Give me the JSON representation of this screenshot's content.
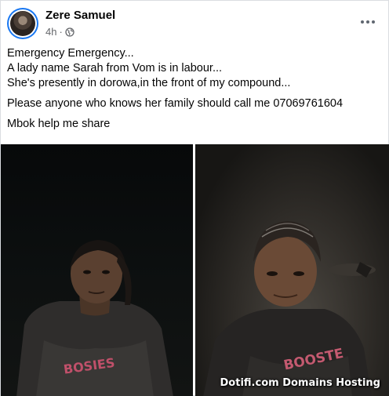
{
  "post": {
    "author": "Zere Samuel",
    "time": "4h",
    "separator": "·",
    "icons": {
      "audience": "globe-icon",
      "menu": "more-options-icon"
    },
    "text": {
      "line1": "Emergency Emergency...",
      "line2": "A lady name Sarah from Vom is in labour...",
      "line3": "She's presently in dorowa,in the front of my compound...",
      "line4": "Please anyone who knows her family should call me 07069761604",
      "line5": "Mbok help me share"
    },
    "photos": {
      "watermark": "Dotifi.com Domains Hosting",
      "left_shirt_text": "BOSIES",
      "right_shirt_text": "BOOSTE"
    }
  },
  "colors": {
    "accent": "#1877f2",
    "secondary_text": "#65676b",
    "primary_text": "#050505"
  }
}
